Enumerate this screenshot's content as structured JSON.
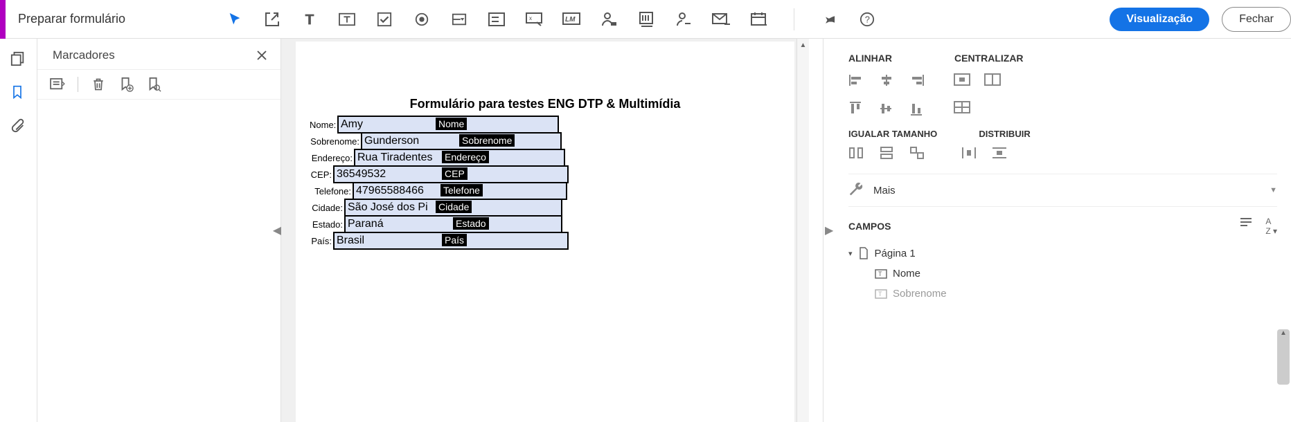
{
  "header": {
    "title": "Preparar formulário",
    "preview_button": "Visualização",
    "close_button": "Fechar"
  },
  "bookmarks": {
    "title": "Marcadores"
  },
  "form": {
    "title": "Formulário para testes ENG DTP & Multimídia",
    "rows": [
      {
        "label": "Nome:",
        "value": "Amy",
        "tag": "Nome"
      },
      {
        "label": "Sobrenome:",
        "value": "Gunderson",
        "tag": "Sobrenome"
      },
      {
        "label": "Endereço:",
        "value": "Rua Tiradentes",
        "tag": "Endereço"
      },
      {
        "label": "CEP:",
        "value": "36549532",
        "tag": "CEP"
      },
      {
        "label": "Telefone:",
        "value": "47965588466",
        "tag": "Telefone"
      },
      {
        "label": "Cidade:",
        "value": "São José dos Pi",
        "tag": "Cidade"
      },
      {
        "label": "Estado:",
        "value": "Paraná",
        "tag": "Estado"
      },
      {
        "label": "País:",
        "value": "Brasil",
        "tag": "País"
      }
    ]
  },
  "rightpanel": {
    "align_label": "ALINHAR",
    "center_label": "CENTRALIZAR",
    "matchsize_label": "IGUALAR TAMANHO",
    "distribute_label": "DISTRIBUIR",
    "more_label": "Mais",
    "fields_label": "CAMPOS",
    "tree_page": "Página 1",
    "tree_field1": "Nome",
    "tree_field2": "Sobrenome"
  }
}
